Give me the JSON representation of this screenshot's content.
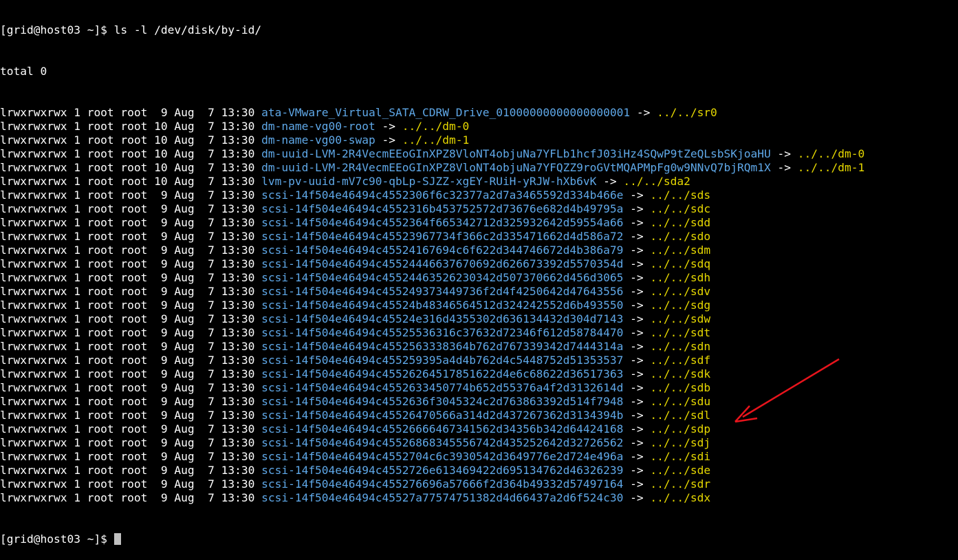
{
  "terminal": {
    "prompt_first": "[grid@host03 ~]$ ls -l /dev/disk/by-id/",
    "total": "total 0",
    "entries": [
      {
        "meta": "lrwxrwxrwx 1 root root  9 Aug  7 13:30 ",
        "name": "ata-VMware_Virtual_SATA_CDRW_Drive_01000000000000000001",
        "arrow": " -> ",
        "target": "../../sr0"
      },
      {
        "meta": "lrwxrwxrwx 1 root root 10 Aug  7 13:30 ",
        "name": "dm-name-vg00-root",
        "arrow": " -> ",
        "target": "../../dm-0"
      },
      {
        "meta": "lrwxrwxrwx 1 root root 10 Aug  7 13:30 ",
        "name": "dm-name-vg00-swap",
        "arrow": " -> ",
        "target": "../../dm-1"
      },
      {
        "meta": "lrwxrwxrwx 1 root root 10 Aug  7 13:30 ",
        "name": "dm-uuid-LVM-2R4VecmEEoGInXPZ8VloNT4objuNa7YFLb1hcfJ03iHz4SQwP9tZeQLsbSKjoaHU",
        "arrow": " -> ",
        "target": "../../dm-0"
      },
      {
        "meta": "lrwxrwxrwx 1 root root 10 Aug  7 13:30 ",
        "name": "dm-uuid-LVM-2R4VecmEEoGInXPZ8VloNT4objuNa7YFQZZ9roGVtMQAPMpFg0w9NNvQ7bjRQm1X",
        "arrow": " -> ",
        "target": "../../dm-1"
      },
      {
        "meta": "lrwxrwxrwx 1 root root 10 Aug  7 13:30 ",
        "name": "lvm-pv-uuid-mV7c90-qbLp-SJZZ-xgEY-RUiH-yRJW-hXb6vK",
        "arrow": " -> ",
        "target": "../../sda2"
      },
      {
        "meta": "lrwxrwxrwx 1 root root  9 Aug  7 13:30 ",
        "name": "scsi-14f504e46494c4552306f6c32377a2d7a3465592d334b466e",
        "arrow": " -> ",
        "target": "../../sds"
      },
      {
        "meta": "lrwxrwxrwx 1 root root  9 Aug  7 13:30 ",
        "name": "scsi-14f504e46494c4552316b453752572d73676e682d4b49795a",
        "arrow": " -> ",
        "target": "../../sdc"
      },
      {
        "meta": "lrwxrwxrwx 1 root root  9 Aug  7 13:30 ",
        "name": "scsi-14f504e46494c4552364f665342712d325932642d59554a66",
        "arrow": " -> ",
        "target": "../../sdd"
      },
      {
        "meta": "lrwxrwxrwx 1 root root  9 Aug  7 13:30 ",
        "name": "scsi-14f504e46494c45523967734f366c2d335471662d4d586a72",
        "arrow": " -> ",
        "target": "../../sdo"
      },
      {
        "meta": "lrwxrwxrwx 1 root root  9 Aug  7 13:30 ",
        "name": "scsi-14f504e46494c45524167694c6f622d344746672d4b386a79",
        "arrow": " -> ",
        "target": "../../sdm"
      },
      {
        "meta": "lrwxrwxrwx 1 root root  9 Aug  7 13:30 ",
        "name": "scsi-14f504e46494c45524446637670692d626673392d5570354d",
        "arrow": " -> ",
        "target": "../../sdq"
      },
      {
        "meta": "lrwxrwxrwx 1 root root  9 Aug  7 13:30 ",
        "name": "scsi-14f504e46494c45524463526230342d507370662d456d3065",
        "arrow": " -> ",
        "target": "../../sdh"
      },
      {
        "meta": "lrwxrwxrwx 1 root root  9 Aug  7 13:30 ",
        "name": "scsi-14f504e46494c455249373449736f2d4f4250642d47643556",
        "arrow": " -> ",
        "target": "../../sdv"
      },
      {
        "meta": "lrwxrwxrwx 1 root root  9 Aug  7 13:30 ",
        "name": "scsi-14f504e46494c45524b48346564512d324242552d6b493550",
        "arrow": " -> ",
        "target": "../../sdg"
      },
      {
        "meta": "lrwxrwxrwx 1 root root  9 Aug  7 13:30 ",
        "name": "scsi-14f504e46494c45524e316d4355302d636134432d304d7143",
        "arrow": " -> ",
        "target": "../../sdw"
      },
      {
        "meta": "lrwxrwxrwx 1 root root  9 Aug  7 13:30 ",
        "name": "scsi-14f504e46494c45525536316c37632d72346f612d58784470",
        "arrow": " -> ",
        "target": "../../sdt"
      },
      {
        "meta": "lrwxrwxrwx 1 root root  9 Aug  7 13:30 ",
        "name": "scsi-14f504e46494c4552563338364b762d767339342d7444314a",
        "arrow": " -> ",
        "target": "../../sdn"
      },
      {
        "meta": "lrwxrwxrwx 1 root root  9 Aug  7 13:30 ",
        "name": "scsi-14f504e46494c455259395a4d4b762d4c5448752d51353537",
        "arrow": " -> ",
        "target": "../../sdf"
      },
      {
        "meta": "lrwxrwxrwx 1 root root  9 Aug  7 13:30 ",
        "name": "scsi-14f504e46494c45526264517851622d4e6c68622d36517363",
        "arrow": " -> ",
        "target": "../../sdk"
      },
      {
        "meta": "lrwxrwxrwx 1 root root  9 Aug  7 13:30 ",
        "name": "scsi-14f504e46494c4552633450774b652d55376a4f2d3132614d",
        "arrow": " -> ",
        "target": "../../sdb"
      },
      {
        "meta": "lrwxrwxrwx 1 root root  9 Aug  7 13:30 ",
        "name": "scsi-14f504e46494c4552636f3045324c2d763863392d514f7948",
        "arrow": " -> ",
        "target": "../../sdu"
      },
      {
        "meta": "lrwxrwxrwx 1 root root  9 Aug  7 13:30 ",
        "name": "scsi-14f504e46494c45526470566a314d2d437267362d3134394b",
        "arrow": " -> ",
        "target": "../../sdl"
      },
      {
        "meta": "lrwxrwxrwx 1 root root  9 Aug  7 13:30 ",
        "name": "scsi-14f504e46494c45526666467341562d34356b342d64424168",
        "arrow": " -> ",
        "target": "../../sdp"
      },
      {
        "meta": "lrwxrwxrwx 1 root root  9 Aug  7 13:30 ",
        "name": "scsi-14f504e46494c45526868345556742d435252642d32726562",
        "arrow": " -> ",
        "target": "../../sdj"
      },
      {
        "meta": "lrwxrwxrwx 1 root root  9 Aug  7 13:30 ",
        "name": "scsi-14f504e46494c4552704c6c3930542d3649776e2d724e496a",
        "arrow": " -> ",
        "target": "../../sdi"
      },
      {
        "meta": "lrwxrwxrwx 1 root root  9 Aug  7 13:30 ",
        "name": "scsi-14f504e46494c4552726e613469422d695134762d46326239",
        "arrow": " -> ",
        "target": "../../sde"
      },
      {
        "meta": "lrwxrwxrwx 1 root root  9 Aug  7 13:30 ",
        "name": "scsi-14f504e46494c455276696a57666f2d364b49332d57497164",
        "arrow": " -> ",
        "target": "../../sdr"
      },
      {
        "meta": "lrwxrwxrwx 1 root root  9 Aug  7 13:30 ",
        "name": "scsi-14f504e46494c45527a77574751382d4d66437a2d6f524c30",
        "arrow": " -> ",
        "target": "../../sdx"
      }
    ],
    "prompt_last": "[grid@host03 ~]$ "
  },
  "colors": {
    "background": "#000000",
    "text": "#ffffff",
    "link_name": "#5fa8e8",
    "link_target": "#e6d800",
    "annotation_arrow": "#e8141c"
  },
  "annotation": {
    "icon": "red-arrow-icon"
  }
}
